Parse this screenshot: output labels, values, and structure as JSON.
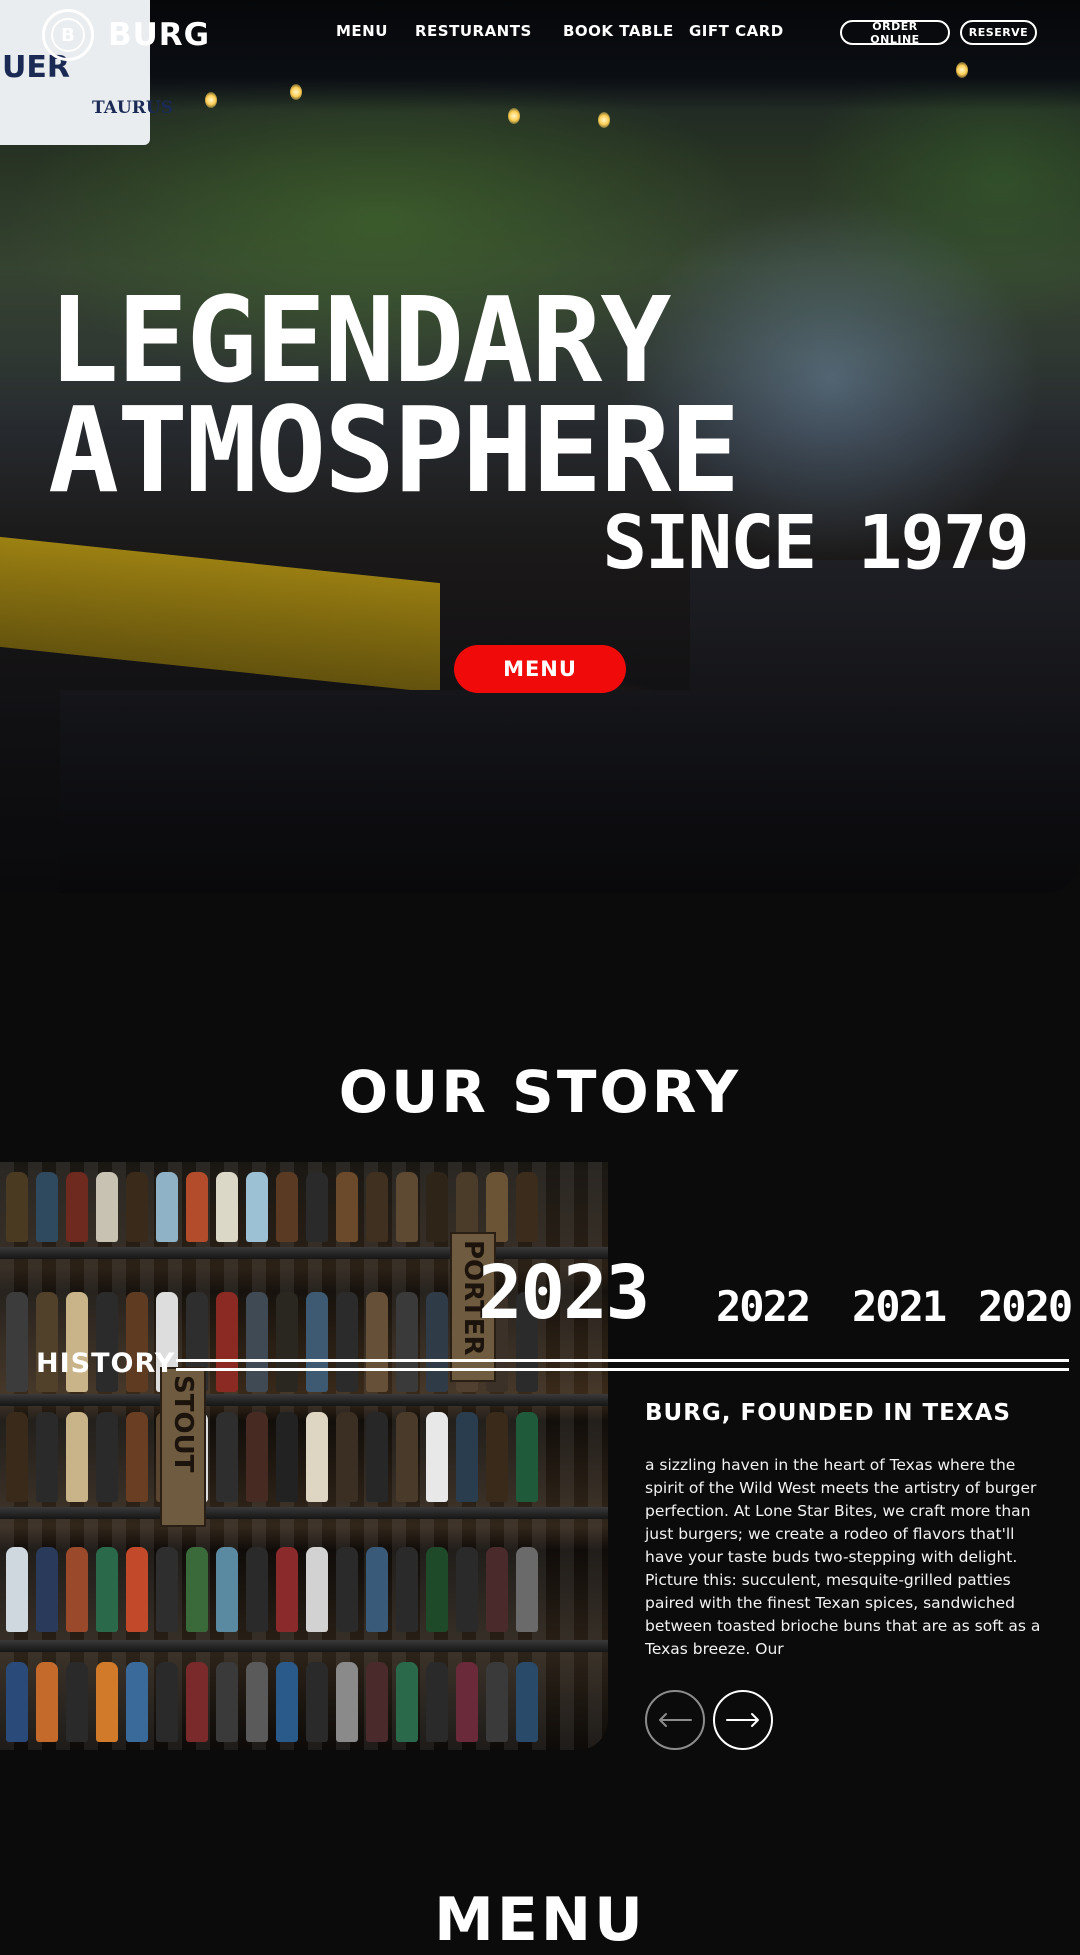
{
  "brand": {
    "name": "BURG",
    "logo_letter": "B"
  },
  "nav": {
    "links": [
      {
        "label": "MENU"
      },
      {
        "label": "RESTURANTS"
      },
      {
        "label": "BOOK TABLE"
      },
      {
        "label": "GIFT CARD"
      }
    ],
    "buttons": {
      "order_online": "ORDER ONLINE",
      "reserve": "RESERVE"
    }
  },
  "hero": {
    "headline_line1": "LEGENDARY",
    "headline_line2": "ATMOSPHERE",
    "since": "SINCE 1979",
    "cta_label": "MENU",
    "cta_color": "#f00a0a",
    "sign_text_line1": "UER",
    "sign_text_line2": "TAURUS"
  },
  "story": {
    "title": "OUR STORY",
    "timeline_label": "HISTORY",
    "years": [
      "2023",
      "2022",
      "2021",
      "2020"
    ],
    "active_year": "2023",
    "heading": "BURG, FOUNDED IN TEXAS",
    "body": "a sizzling haven in the heart of Texas where the spirit of the Wild West meets the artistry of burger perfection. At Lone Star Bites, we craft more than just burgers; we create a rodeo of flavors that'll have your taste buds two-stepping with delight.\nPicture this: succulent, mesquite-grilled patties paired with the finest Texan spices, sandwiched between toasted brioche buns that are as soft as a Texas breeze. Our",
    "photo_signs": [
      "STOUT",
      "PORTER"
    ]
  },
  "menu_section": {
    "title": "MENU"
  },
  "icons": {
    "prev": "arrow-left-icon",
    "next": "arrow-right-icon",
    "logo": "burg-logo-icon"
  }
}
